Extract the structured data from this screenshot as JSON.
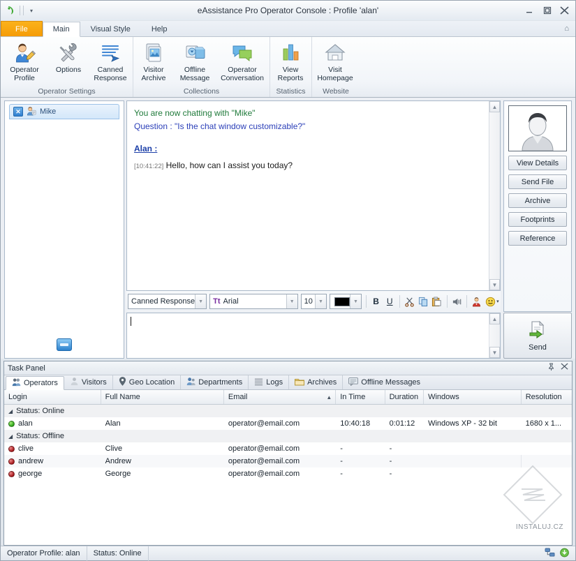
{
  "window": {
    "title": "eAssistance Pro Operator Console : Profile 'alan'",
    "app_icon": "phone-icon",
    "quick_access_dropdown": "▾",
    "buttons": {
      "minimize": "—",
      "maximize": "❐",
      "close": "✕"
    }
  },
  "ribbon": {
    "tabs": [
      {
        "label": "File",
        "active": false,
        "style": "file"
      },
      {
        "label": "Main",
        "active": true,
        "style": "normal"
      },
      {
        "label": "Visual Style",
        "active": false,
        "style": "normal"
      },
      {
        "label": "Help",
        "active": false,
        "style": "normal"
      }
    ],
    "help_icon": "⌂",
    "groups": [
      {
        "title": "Operator Settings",
        "items": [
          {
            "line1": "Operator",
            "line2": "Profile",
            "icon": "operator-profile-icon"
          },
          {
            "line1": "Options",
            "line2": "",
            "icon": "options-tools-icon"
          },
          {
            "line1": "Canned",
            "line2": "Response",
            "icon": "canned-response-icon"
          }
        ]
      },
      {
        "title": "Collections",
        "items": [
          {
            "line1": "Visitor",
            "line2": "Archive",
            "icon": "visitor-archive-icon"
          },
          {
            "line1": "Offline",
            "line2": "Message",
            "icon": "offline-message-icon"
          },
          {
            "line1": "Operator",
            "line2": "Conversation",
            "icon": "operator-conversation-icon"
          }
        ]
      },
      {
        "title": "Statistics",
        "items": [
          {
            "line1": "View",
            "line2": "Reports",
            "icon": "view-reports-icon"
          }
        ]
      },
      {
        "title": "Website",
        "items": [
          {
            "line1": "Visit",
            "line2": "Homepage",
            "icon": "visit-homepage-icon"
          }
        ]
      }
    ]
  },
  "left_pane": {
    "visitor_tab": {
      "name": "Mike",
      "close_label": "✕",
      "icon": "visitor-person-icon"
    },
    "bottom_button_icon": "message-window-icon"
  },
  "chat": {
    "system_line": "You are now chatting with \"Mike\"",
    "question_line": "Question : \"Is the chat window customizable?\"",
    "operator_name": "Alan :",
    "message_time": "[10:41:22]",
    "message_text": "Hello, how can I assist you today?"
  },
  "format_bar": {
    "canned_response": "Canned Response",
    "font_family": "Arial",
    "font_family_icon": "Tt",
    "font_size": "10",
    "color_value": "#000000",
    "bold": "B",
    "underline": "U",
    "cut_icon": "cut-scissors-icon",
    "copy_icon": "copy-icon",
    "paste_icon": "paste-icon",
    "sound_icon": "sound-icon",
    "contact_icon": "operator-card-icon",
    "emoticon_icon": "smiley-icon",
    "emoticon_arrow": "▾"
  },
  "compose": {
    "value": "",
    "placeholder": ""
  },
  "right_pane": {
    "avatar_icon": "visitor-avatar-icon",
    "buttons": [
      "View Details",
      "Send File",
      "Archive",
      "Footprints",
      "Reference"
    ],
    "send": {
      "label": "Send",
      "icon": "send-document-icon"
    }
  },
  "task_panel": {
    "title": "Task Panel",
    "pin_icon": "pin-icon",
    "close_icon": "close-icon",
    "tabs": [
      {
        "label": "Operators",
        "icon": "operators-icon",
        "active": true
      },
      {
        "label": "Visitors",
        "icon": "visitors-icon",
        "active": false
      },
      {
        "label": "Geo Location",
        "icon": "geo-pin-icon",
        "active": false
      },
      {
        "label": "Departments",
        "icon": "departments-icon",
        "active": false
      },
      {
        "label": "Logs",
        "icon": "logs-icon",
        "active": false
      },
      {
        "label": "Archives",
        "icon": "archives-folder-icon",
        "active": false
      },
      {
        "label": "Offline Messages",
        "icon": "offline-messages-icon",
        "active": false
      }
    ],
    "columns": [
      {
        "label": "Login",
        "width": 140,
        "sorted": false
      },
      {
        "label": "Full Name",
        "width": 178,
        "sorted": false
      },
      {
        "label": "Email",
        "width": 162,
        "sorted": true,
        "sort_arrow": "▲"
      },
      {
        "label": "In Time",
        "width": 71,
        "sorted": false
      },
      {
        "label": "Duration",
        "width": 56,
        "sorted": false
      },
      {
        "label": "Windows",
        "width": 141,
        "sorted": false
      },
      {
        "label": "Resolution",
        "width": 73,
        "sorted": false
      }
    ],
    "groups": [
      {
        "group_label": "Status:  Online",
        "collapse_arrow": "◢",
        "rows": [
          {
            "status": "online",
            "login": "alan",
            "full_name": "Alan",
            "email": "operator@email.com",
            "in_time": "10:40:18",
            "duration": "0:01:12",
            "windows": "Windows XP - 32 bit",
            "resolution": "1680 x 1..."
          }
        ]
      },
      {
        "group_label": "Status:  Offline",
        "collapse_arrow": "◢",
        "rows": [
          {
            "status": "offline",
            "login": "clive",
            "full_name": "Clive",
            "email": "operator@email.com",
            "in_time": "-",
            "duration": "-",
            "windows": "",
            "resolution": ""
          },
          {
            "status": "offline",
            "login": "andrew",
            "full_name": "Andrew",
            "email": "operator@email.com",
            "in_time": "-",
            "duration": "-",
            "windows": "",
            "resolution": ""
          },
          {
            "status": "offline",
            "login": "george",
            "full_name": "George",
            "email": "operator@email.com",
            "in_time": "-",
            "duration": "-",
            "windows": "",
            "resolution": ""
          }
        ]
      }
    ],
    "watermark_text": "INSTALUJ.CZ"
  },
  "status_bar": {
    "profile": "Operator Profile: alan",
    "status": "Status: Online",
    "tray": [
      "network-icon",
      "update-icon"
    ]
  },
  "colors": {
    "accent_orange": "#f7a60b",
    "online_green": "#2da318",
    "offline_red": "#a3161a",
    "link_blue": "#1c3fa8",
    "system_green": "#1f7a3a"
  }
}
